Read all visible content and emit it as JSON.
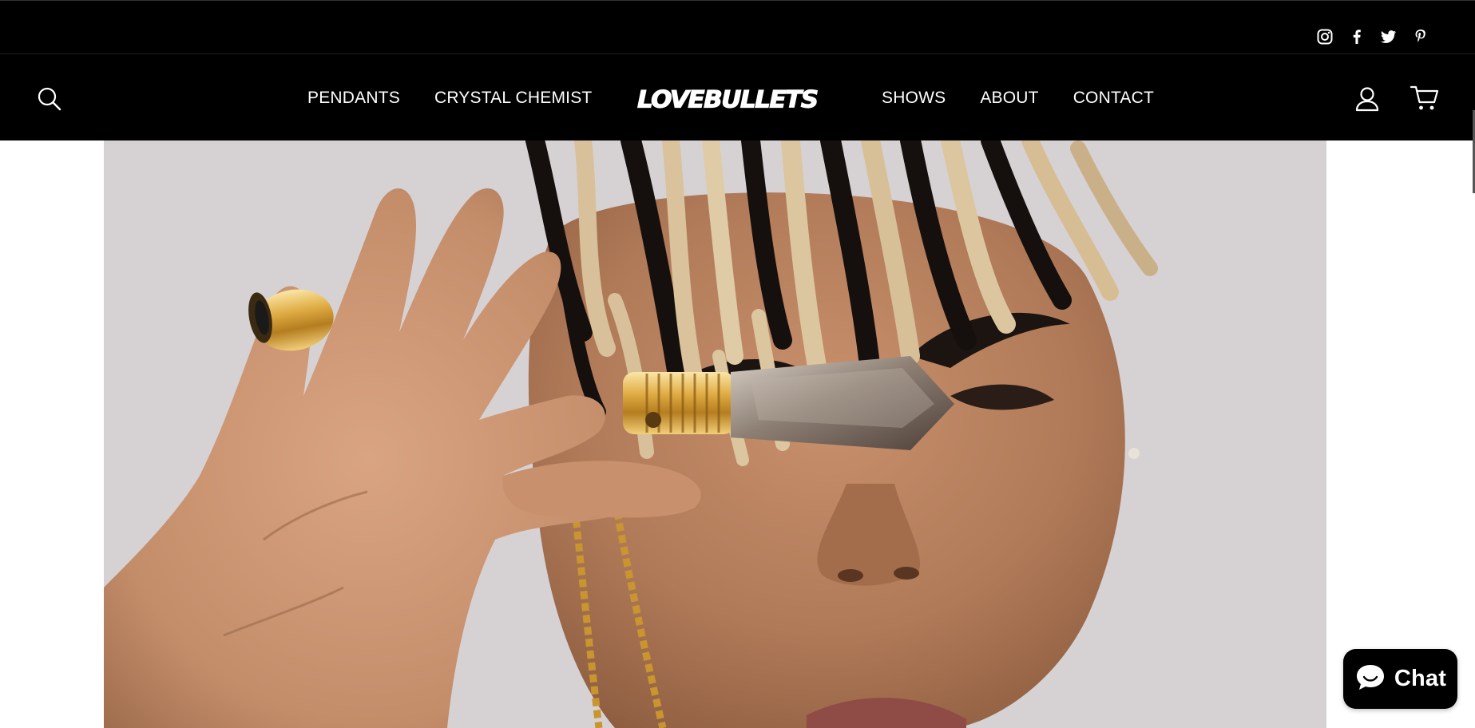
{
  "top_bar": {
    "social_links": [
      {
        "icon": "instagram-icon",
        "label": "Instagram"
      },
      {
        "icon": "facebook-icon",
        "label": "Facebook"
      },
      {
        "icon": "twitter-icon",
        "label": "Twitter"
      },
      {
        "icon": "pinterest-icon",
        "label": "Pinterest"
      }
    ]
  },
  "header": {
    "logo_text": "LOVEBULLETS",
    "nav_left": [
      "PENDANTS",
      "CRYSTAL CHEMIST"
    ],
    "nav_right": [
      "SHOWS",
      "ABOUT",
      "CONTACT"
    ],
    "icons": {
      "search": "search-icon",
      "account": "account-icon",
      "cart": "cart-icon"
    }
  },
  "hero": {
    "image": "model-holding-crystal-pendant"
  },
  "chat": {
    "label": "Chat",
    "icon": "chat-bubble-icon"
  },
  "colors": {
    "header_bg": "#000000",
    "header_text": "#ffffff",
    "page_bg": "#ffffff",
    "gold": "#d4a437"
  }
}
